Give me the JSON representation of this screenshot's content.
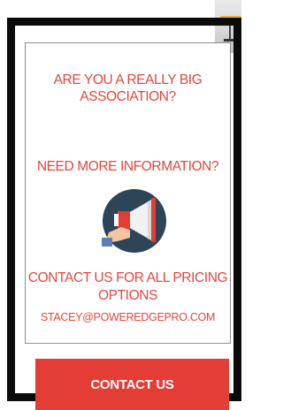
{
  "promo": {
    "question_association": "ARE YOU A REALLY BIG ASSOCIATION?",
    "question_information": "NEED MORE INFORMATION?",
    "contact_pricing": "CONTACT US FOR ALL PRICING OPTIONS",
    "email": "STACEY@POWEREDGEPRO.COM",
    "icon": "megaphone-icon",
    "cta_label": "CONTACT US"
  },
  "colors": {
    "accent": "#e2473d",
    "button": "#e43d36",
    "frame": "#0b0b0b",
    "icon_circle": "#2e4457"
  }
}
